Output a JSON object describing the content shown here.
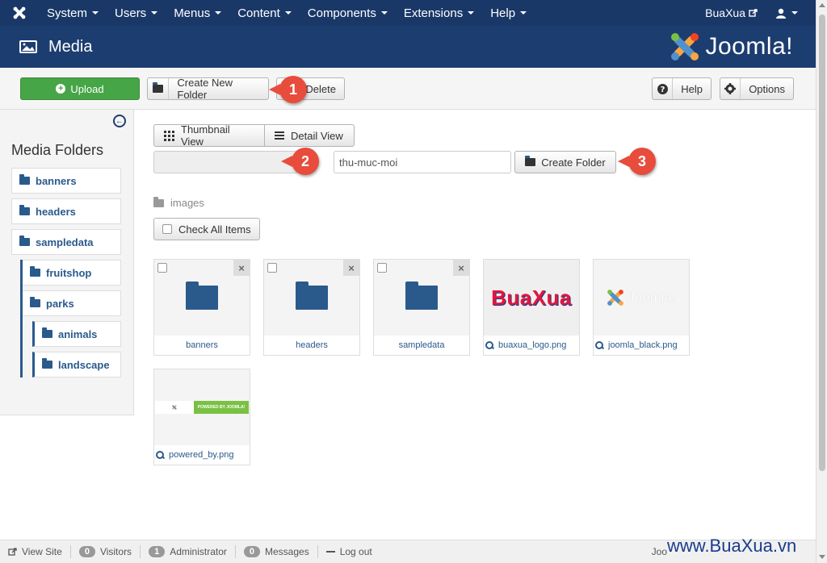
{
  "topnav": {
    "menu": [
      "System",
      "Users",
      "Menus",
      "Content",
      "Components",
      "Extensions",
      "Help"
    ],
    "site_name": "BuaXua"
  },
  "header": {
    "title": "Media",
    "brand": "Joomla!"
  },
  "toolbar": {
    "upload_label": "Upload",
    "create_new_folder_label": "Create New Folder",
    "delete_label": "Delete",
    "help_label": "Help",
    "options_label": "Options"
  },
  "callouts": {
    "one": "1",
    "two": "2",
    "three": "3"
  },
  "sidebar": {
    "title": "Media Folders",
    "folders": [
      {
        "label": "banners"
      },
      {
        "label": "headers"
      },
      {
        "label": "sampledata"
      },
      {
        "label": "fruitshop"
      },
      {
        "label": "parks"
      },
      {
        "label": "animals"
      },
      {
        "label": "landscape"
      }
    ]
  },
  "main": {
    "thumbnail_view_label": "Thumbnail View",
    "detail_view_label": "Detail View",
    "folder_path_value": "",
    "folder_name_value": "thu-muc-moi",
    "create_folder_label": "Create Folder",
    "breadcrumb": "images",
    "check_all_label": "Check All Items",
    "items": [
      {
        "label": "banners",
        "kind": "folder"
      },
      {
        "label": "headers",
        "kind": "folder"
      },
      {
        "label": "sampledata",
        "kind": "folder"
      },
      {
        "label": "buaxua_logo.png",
        "kind": "image",
        "thumb_text": "BuaXua"
      },
      {
        "label": "joomla_black.png",
        "kind": "image",
        "thumb_text": "Joomla!"
      },
      {
        "label": "powered_by.png",
        "kind": "image",
        "thumb_text": "POWERED BY JOOMLA!"
      }
    ]
  },
  "statusbar": {
    "view_site": "View Site",
    "visitors_count": "0",
    "visitors_label": "Visitors",
    "admin_count": "1",
    "admin_label": "Administrator",
    "messages_count": "0",
    "messages_label": "Messages",
    "logout_label": "Log out",
    "right_text": "Joo"
  },
  "watermark": "www.BuaXua.vn",
  "colors": {
    "navbar": "#1a3867",
    "header": "#1c3d70",
    "upload": "#46a546",
    "callout": "#e74c3c",
    "link": "#2a5a8c"
  }
}
